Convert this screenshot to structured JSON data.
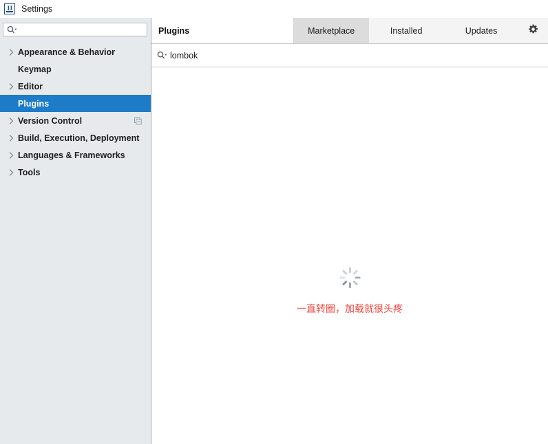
{
  "window": {
    "title": "Settings",
    "app_icon": "intellij-idea-icon"
  },
  "sidebar": {
    "search": {
      "value": "",
      "placeholder": "",
      "icon": "search-icon"
    },
    "items": [
      {
        "label": "Appearance & Behavior",
        "expandable": true,
        "selected": false,
        "badge": ""
      },
      {
        "label": "Keymap",
        "expandable": false,
        "selected": false,
        "badge": ""
      },
      {
        "label": "Editor",
        "expandable": true,
        "selected": false,
        "badge": ""
      },
      {
        "label": "Plugins",
        "expandable": false,
        "selected": true,
        "badge": ""
      },
      {
        "label": "Version Control",
        "expandable": true,
        "selected": false,
        "badge": "copy-icon"
      },
      {
        "label": "Build, Execution, Deployment",
        "expandable": true,
        "selected": false,
        "badge": ""
      },
      {
        "label": "Languages & Frameworks",
        "expandable": true,
        "selected": false,
        "badge": ""
      },
      {
        "label": "Tools",
        "expandable": true,
        "selected": false,
        "badge": ""
      }
    ]
  },
  "main": {
    "panel_title": "Plugins",
    "tabs": [
      {
        "label": "Marketplace",
        "active": true
      },
      {
        "label": "Installed",
        "active": false
      },
      {
        "label": "Updates",
        "active": false
      }
    ],
    "settings_icon": "gear-icon",
    "plugin_search": {
      "value": "lombok",
      "placeholder": "",
      "icon": "search-icon"
    },
    "loading": {
      "spinner_icon": "loading-spinner-icon",
      "message": "一直转圈，加载就很头疼"
    }
  },
  "colors": {
    "selection_blue": "#1e7bc8",
    "sidebar_bg": "#e6eaed",
    "tab_active_bg": "#dcdcdc",
    "tabbar_bg": "#f4f4f4",
    "error_red": "#f4453d"
  }
}
